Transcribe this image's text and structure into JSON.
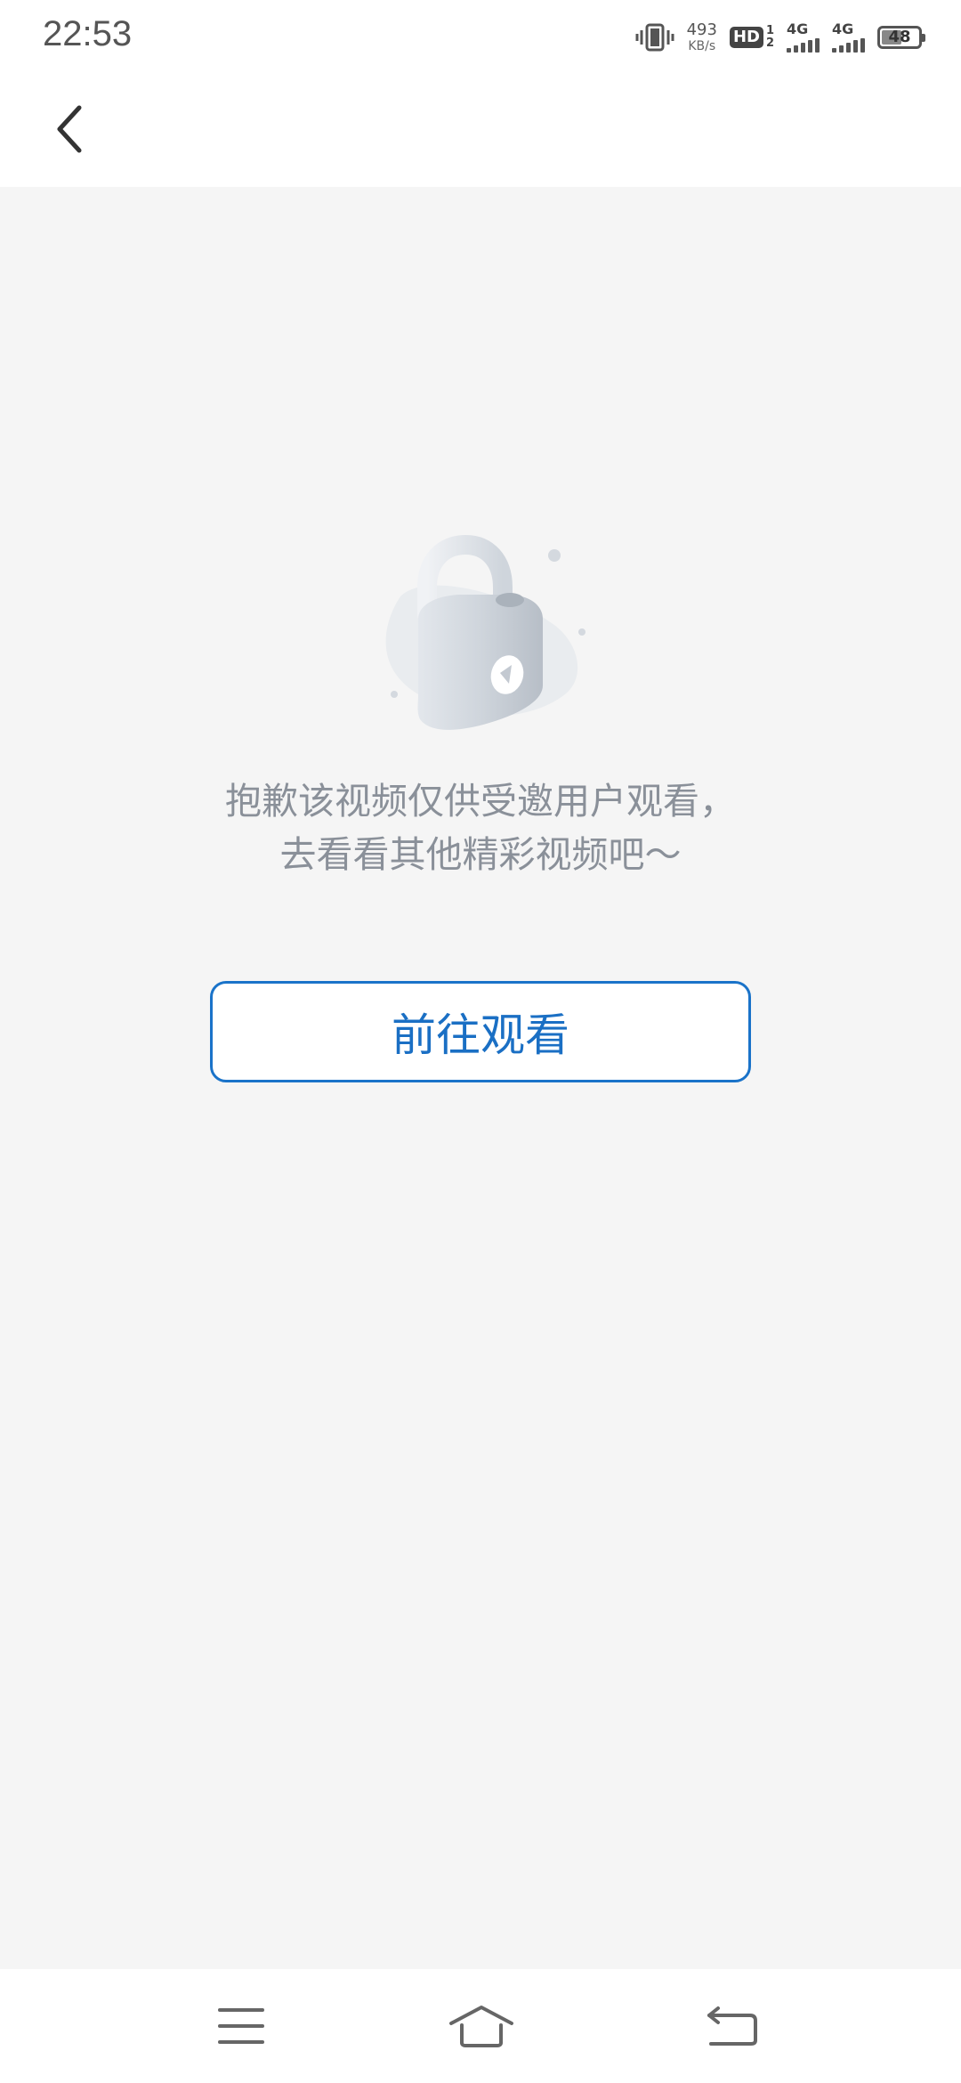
{
  "status_bar": {
    "time": "22:53",
    "net_speed_value": "493",
    "net_speed_unit": "KB/s",
    "hd_label": "HD",
    "hd_sim_1": "1",
    "hd_sim_2": "2",
    "network_1": "4G",
    "network_2": "4G",
    "battery_level": "48"
  },
  "message": {
    "line1": "抱歉该视频仅供受邀用户观看，",
    "line2": "去看看其他精彩视频吧～"
  },
  "actions": {
    "go_watch_label": "前往观看"
  },
  "colors": {
    "accent": "#1a6fc4",
    "background": "#f5f5f5",
    "message_text": "#8a9099"
  },
  "icons": {
    "back": "chevron-left-icon",
    "lock": "lock-icon",
    "menu": "menu-icon",
    "home": "home-icon",
    "nav_back": "return-icon"
  }
}
